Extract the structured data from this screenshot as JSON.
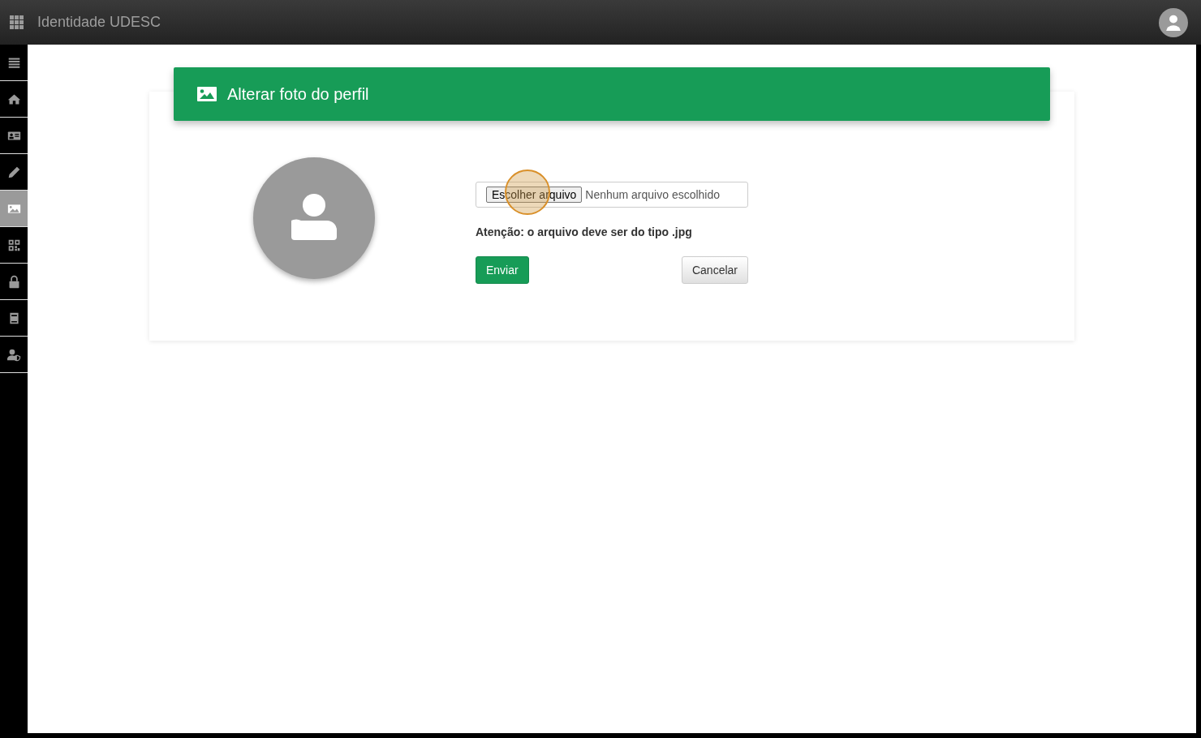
{
  "app_bar": {
    "title": "Identidade UDESC"
  },
  "sidebar": {
    "items": [
      {
        "kind": "menu",
        "selected": false
      },
      {
        "kind": "home",
        "selected": false
      },
      {
        "kind": "id-card",
        "selected": false
      },
      {
        "kind": "pencil",
        "selected": false
      },
      {
        "kind": "image",
        "selected": true
      },
      {
        "kind": "qr",
        "selected": false
      },
      {
        "kind": "lock",
        "selected": false
      },
      {
        "kind": "book",
        "selected": false
      },
      {
        "kind": "user-shield",
        "selected": false
      }
    ]
  },
  "card": {
    "title": "Alterar foto do perfil",
    "file_input": {
      "button": "Escolher arquivo",
      "status": "Nenhum arquivo escolhido"
    },
    "notice": "Atenção: o arquivo deve ser do tipo .jpg",
    "buttons": [
      {
        "label": "Enviar",
        "kind": "primary"
      },
      {
        "label": "Cancelar",
        "kind": "default"
      }
    ]
  }
}
